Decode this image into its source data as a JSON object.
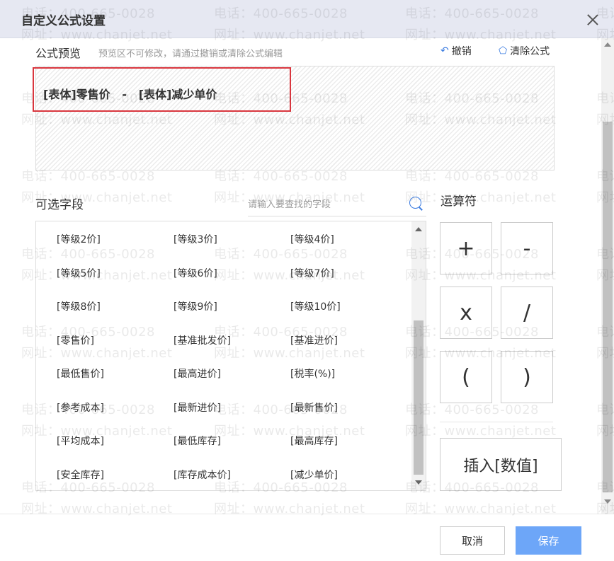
{
  "dialog": {
    "title": "自定义公式设置"
  },
  "preview": {
    "label": "公式预览",
    "hint": "预览区不可修改，请通过撤销或清除公式编辑",
    "undo_label": "撤销",
    "clear_label": "清除公式",
    "formula": "[表体]零售价   -   [表体]减少单价"
  },
  "fields": {
    "label": "可选字段",
    "search_placeholder": "请输入要查找的字段",
    "items": [
      "[等级2价]",
      "[等级3价]",
      "[等级4价]",
      "[等级5价]",
      "[等级6价]",
      "[等级7价]",
      "[等级8价]",
      "[等级9价]",
      "[等级10价]",
      "[零售价]",
      "[基准批发价]",
      "[基准进价]",
      "[最低售价]",
      "[最高进价]",
      "[税率(%)]",
      "[参考成本]",
      "[最新进价]",
      "[最新售价]",
      "[平均成本]",
      "[最低库存]",
      "[最高库存]",
      "[安全库存]",
      "[库存成本价]",
      "[减少单价]"
    ]
  },
  "operators": {
    "label": "运算符",
    "items": [
      "+",
      "-",
      "x",
      "/",
      "(",
      ")"
    ],
    "insert_value_label": "插入[数值]"
  },
  "footer": {
    "cancel_label": "取消",
    "save_label": "保存"
  },
  "watermark": {
    "phone": "电话：400-665-0028",
    "site": "网址：www.chanjet.net"
  },
  "colors": {
    "accent": "#3a7be0",
    "save_button": "#6da6f8",
    "highlight_border": "#d9363e",
    "header_bg": "#e6e8f2"
  }
}
